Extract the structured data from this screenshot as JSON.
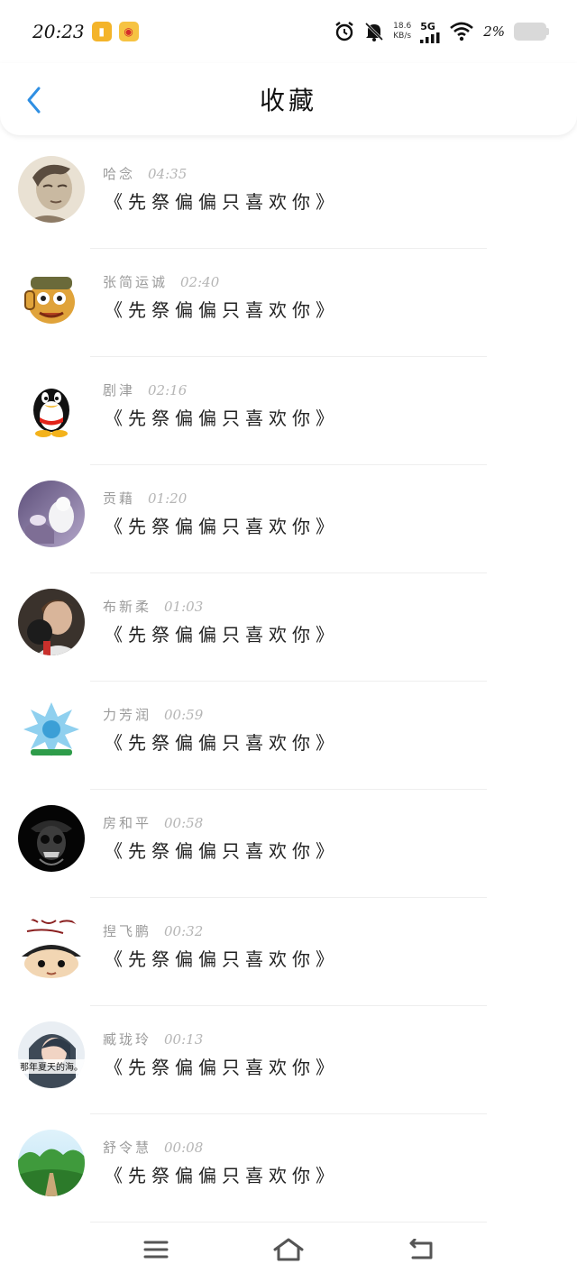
{
  "status_bar": {
    "time": "20:23",
    "net_speed_top": "18.6",
    "net_speed_bottom": "KB/s",
    "network": "5G",
    "battery": "2%"
  },
  "header": {
    "title": "收藏"
  },
  "colors": {
    "accent": "#2f8fe3",
    "divider": "#eeeeee",
    "meta_text": "#9b9b9b"
  },
  "favorites": [
    {
      "user": "哈念",
      "time": "04:35",
      "song": "《先祭偏偏只喜欢你》",
      "avatar": "portrait-sketch"
    },
    {
      "user": "张简运诚",
      "time": "02:40",
      "song": "《先祭偏偏只喜欢你》",
      "avatar": "cartoon-character"
    },
    {
      "user": "剧津",
      "time": "02:16",
      "song": "《先祭偏偏只喜欢你》",
      "avatar": "qq-penguin"
    },
    {
      "user": "贡藉",
      "time": "01:20",
      "song": "《先祭偏偏只喜欢你》",
      "avatar": "white-dog"
    },
    {
      "user": "布新柔",
      "time": "01:03",
      "song": "《先祭偏偏只喜欢你》",
      "avatar": "boy-photo"
    },
    {
      "user": "力芳润",
      "time": "00:59",
      "song": "《先祭偏偏只喜欢你》",
      "avatar": "ice-dragon"
    },
    {
      "user": "房和平",
      "time": "00:58",
      "song": "《先祭偏偏只喜欢你》",
      "avatar": "skull-dark"
    },
    {
      "user": "揑飞鹏",
      "time": "00:32",
      "song": "《先祭偏偏只喜欢你》",
      "avatar": "cartoon-face"
    },
    {
      "user": "臧珑玲",
      "time": "00:13",
      "song": "《先祭偏偏只喜欢你》",
      "avatar": "girl-photo",
      "avatar_caption": "那年夏天的海。"
    },
    {
      "user": "舒令慧",
      "time": "00:08",
      "song": "《先祭偏偏只喜欢你》",
      "avatar": "green-landscape"
    }
  ],
  "bottom_bar": {
    "menu_icon": "menu-icon",
    "home_icon": "home-icon",
    "back_icon": "back-icon"
  }
}
